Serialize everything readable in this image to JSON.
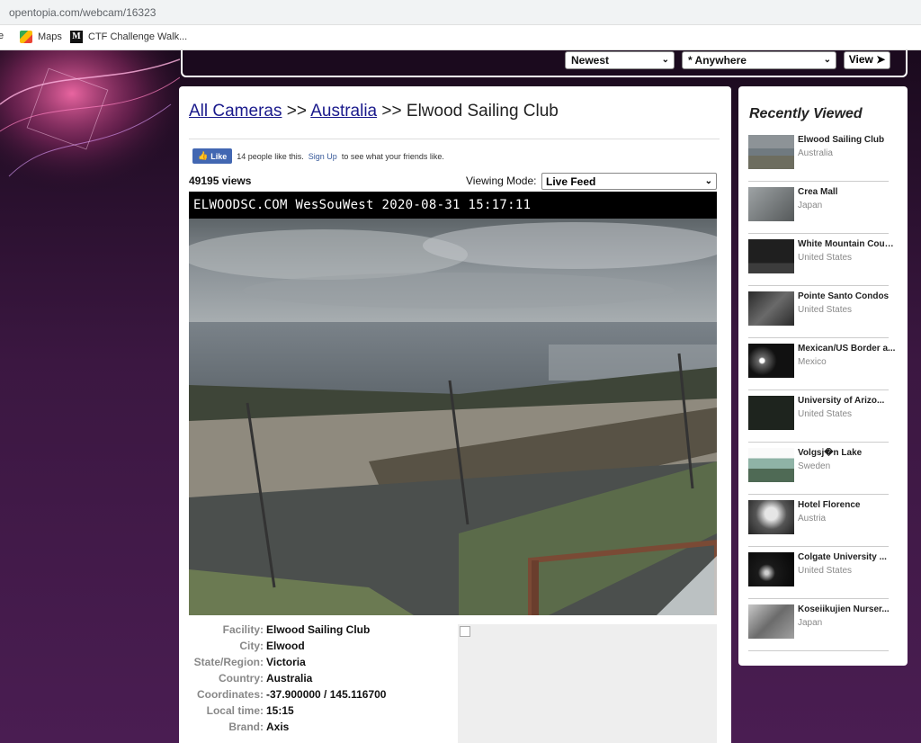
{
  "browser": {
    "url": "opentopia.com/webcam/16323",
    "bookmarks": [
      {
        "label": "e",
        "icon": "partial-icon"
      },
      {
        "label": "Maps",
        "icon": "maps-icon"
      },
      {
        "label": "CTF Challenge Walk...",
        "icon": "medium-m-icon"
      }
    ]
  },
  "topbar": {
    "sort_value": "Newest",
    "location_value": "* Anywhere",
    "view_label": "View ➤"
  },
  "main": {
    "breadcrumb": {
      "all_cameras": "All Cameras",
      "sep": ">>",
      "country": "Australia",
      "current": "Elwood Sailing Club"
    },
    "like": {
      "button": "Like",
      "text_before": "14 people like this.",
      "signup": "Sign Up",
      "text_after": "to see what your friends like."
    },
    "views": "49195 views",
    "viewing_mode_label": "Viewing Mode:",
    "viewing_mode_value": "Live Feed",
    "cam_caption": "ELWOODSC.COM WesSouWest 2020-08-31 15:17:11",
    "info": [
      {
        "key": "Facility:",
        "value": "Elwood Sailing Club"
      },
      {
        "key": "City:",
        "value": "Elwood"
      },
      {
        "key": "State/Region:",
        "value": "Victoria"
      },
      {
        "key": "Country:",
        "value": "Australia"
      },
      {
        "key": "Coordinates:",
        "value": "-37.900000 / 145.116700"
      },
      {
        "key": "Local time:",
        "value": "15:15"
      },
      {
        "key": "Brand:",
        "value": "Axis"
      }
    ]
  },
  "sidebar": {
    "title": "Recently Viewed",
    "items": [
      {
        "name": "Elwood Sailing Club",
        "country": "Australia"
      },
      {
        "name": "Crea Mall",
        "country": "Japan"
      },
      {
        "name": "White Mountain Coun...",
        "country": "United States"
      },
      {
        "name": "Pointe Santo Condos",
        "country": "United States"
      },
      {
        "name": "Mexican/US Border a...",
        "country": "Mexico"
      },
      {
        "name": "University of Arizo...",
        "country": "United States"
      },
      {
        "name": "Volgsj�n Lake",
        "country": "Sweden"
      },
      {
        "name": "Hotel Florence",
        "country": "Austria"
      },
      {
        "name": "Colgate University ...",
        "country": "United States"
      },
      {
        "name": "Koseiikujien Nurser...",
        "country": "Japan"
      }
    ]
  }
}
